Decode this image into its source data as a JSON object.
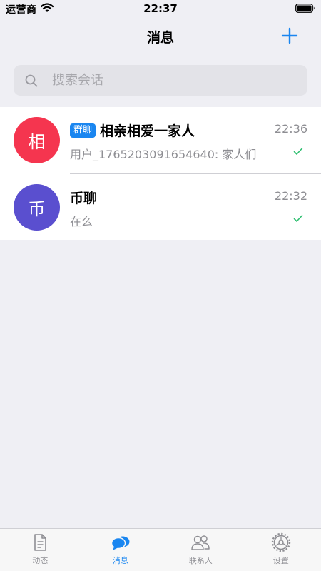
{
  "status_bar": {
    "carrier": "运营商",
    "time": "22:37"
  },
  "nav": {
    "title": "消息"
  },
  "search": {
    "placeholder": "搜索会话"
  },
  "conversations": [
    {
      "avatar_text": "相",
      "avatar_color": "#f5354f",
      "badge": "群聊",
      "name": "相亲相爱一家人",
      "time": "22:36",
      "preview": "用户_1765203091654640: 家人们"
    },
    {
      "avatar_text": "币",
      "avatar_color": "#5a4fcf",
      "name": "币聊",
      "time": "22:32",
      "preview": "在么"
    }
  ],
  "tabs": [
    {
      "label": "动态",
      "icon": "document-icon"
    },
    {
      "label": "消息",
      "icon": "chat-bubbles-icon",
      "active": true
    },
    {
      "label": "联系人",
      "icon": "contacts-icon"
    },
    {
      "label": "设置",
      "icon": "settings-gear-icon"
    }
  ],
  "colors": {
    "accent": "#1a86f0",
    "check": "#2fbf71",
    "background": "#efeff4"
  }
}
